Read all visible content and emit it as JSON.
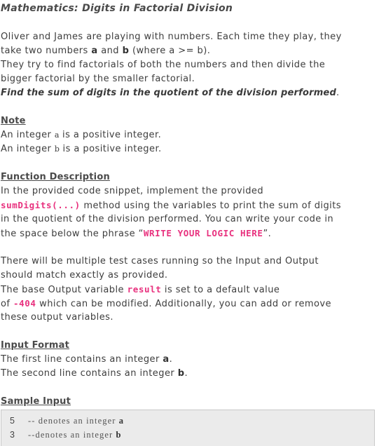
{
  "title": "Mathematics: Digits in Factorial Division",
  "intro": {
    "line1": "Oliver and James are playing with numbers. Each time they play, they",
    "line2_pre": "take two numbers ",
    "var_a": "a",
    "line2_mid": " and ",
    "var_b": "b",
    "line2_post": " (where a >= b).",
    "line3": "They try to find factorials of both the numbers and then divide the",
    "line4": "bigger factorial by the smaller factorial.",
    "line5_em": "Find the sum of digits in the quotient of the division performed",
    "line5_post": "."
  },
  "note": {
    "heading": "Note",
    "line1_pre": "An integer ",
    "line1_var": "a",
    "line1_post": " is a positive integer.",
    "line2_pre": "An integer ",
    "line2_var": "b",
    "line2_post": "  is a positive integer."
  },
  "function_description": {
    "heading": "Function Description",
    "line1": "In the provided code snippet, implement the provided",
    "method": "sumDigits(...)",
    "line2_post": "  method using the variables to print the sum of digits",
    "line3": "in the quotient of the division performed. You can write your code in",
    "line4_pre": "the space below the phrase “",
    "phrase": "WRITE YOUR LOGIC HERE",
    "line4_post": "”."
  },
  "output_notes": {
    "line1": "There will be multiple test cases running so the Input and Output",
    "line2": "should match exactly as provided.",
    "line3_pre": "The base Output variable ",
    "variable": "result",
    "line3_post": " is set to a default value",
    "line4_pre": "of  ",
    "default_value": "-404",
    "line4_post": " which can be modified. Additionally, you can add or remove",
    "line5": "these output variables."
  },
  "input_format": {
    "heading": "Input Format",
    "line1_pre": "The first line contains an integer ",
    "line1_var": "a",
    "line1_post": ".",
    "line2_pre": "The second line contains an integer ",
    "line2_var": "b",
    "line2_post": "."
  },
  "sample_input": {
    "heading": "Sample Input",
    "rows": [
      {
        "value": "5",
        "comment": "-- denotes an integer ",
        "var": "a"
      },
      {
        "value": "3",
        "comment": "--denotes an integer ",
        "var": "b"
      }
    ]
  }
}
